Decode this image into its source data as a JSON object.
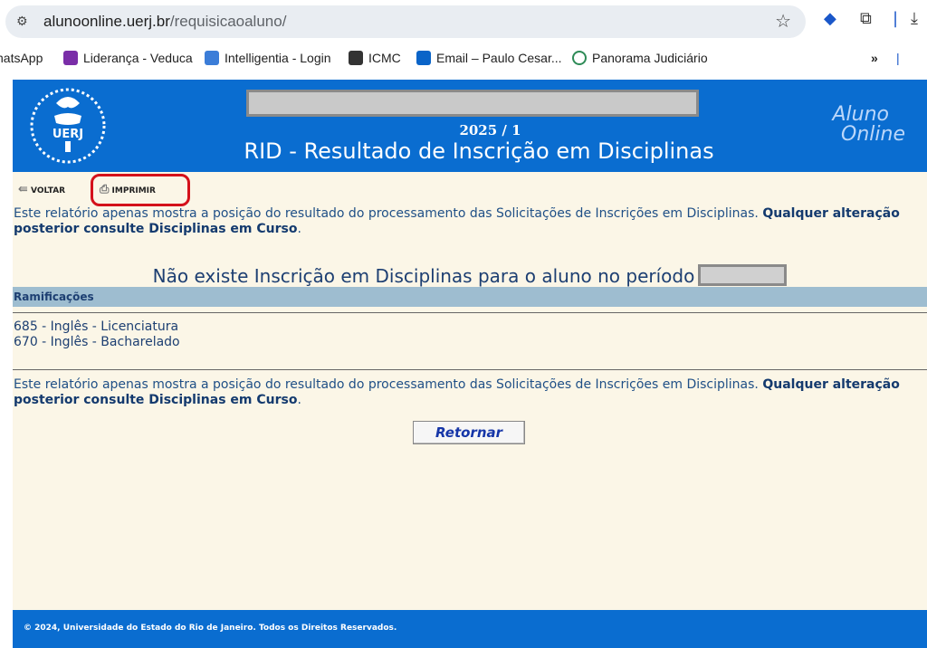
{
  "browser": {
    "url_host": "alunoonline.uerj.br",
    "url_path": "/requisicaoaluno/",
    "bookmarks": [
      {
        "label": "hatsApp",
        "color": "#25d366"
      },
      {
        "label": "Liderança - Veduca",
        "color": "#7a2ea8"
      },
      {
        "label": "Intelligentia - Login",
        "color": "#3b7dd8"
      },
      {
        "label": "ICMC",
        "color": "#333333"
      },
      {
        "label": "Email – Paulo Cesar...",
        "color": "#0a64c8"
      },
      {
        "label": "Panorama Judiciário",
        "color": "#2e8b57"
      }
    ],
    "more": "»"
  },
  "header": {
    "term": "2025 / 1",
    "title": "RID - Resultado de Inscrição em Disciplinas",
    "brand_line1": "Aluno",
    "brand_line2": "Online",
    "logo_text": "UERJ"
  },
  "toolbar": {
    "back_label": "VOLTAR",
    "print_label": "IMPRIMIR"
  },
  "notice": {
    "text": "Este relatório apenas mostra a posição do resultado do processamento das Solicitações de Inscrições em Disciplinas. ",
    "bold": "Qualquer alteração posterior consulte Disciplinas em Curso",
    "end": "."
  },
  "main": {
    "no_enrollment": "Não existe Inscrição em Disciplinas para o aluno no período",
    "ramificacoes_header": "Ramificações",
    "ramificacoes": [
      "685 - Inglês - Licenciatura",
      "670 - Inglês - Bacharelado"
    ],
    "return_button": "Retornar"
  },
  "footer": {
    "text": "© 2024, Universidade do Estado do Rio de Janeiro. Todos os Direitos Reservados."
  }
}
